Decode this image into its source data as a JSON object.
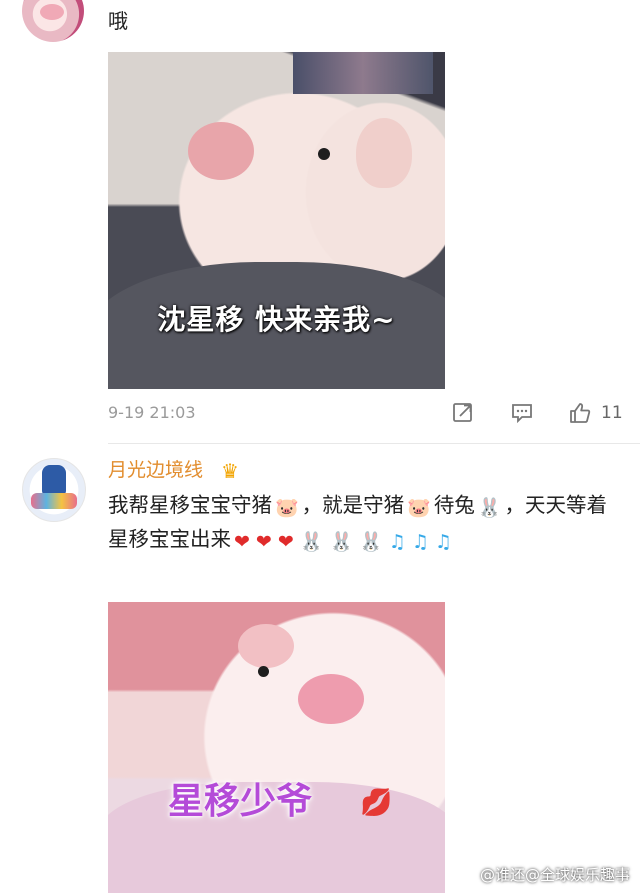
{
  "post1": {
    "text": "哦",
    "image_caption": "沈星移 快来亲我~",
    "time": "9-19 21:03",
    "likes": "11"
  },
  "post2": {
    "username": "月光边境线",
    "badge_icon": "crown-icon",
    "comment_line1": "我帮星移宝宝守猪",
    "comment_line2": "，就是守猪",
    "comment_line3": "待兔",
    "comment_line4": "，天天等着星移宝宝出来",
    "image_caption": "星移少爷"
  },
  "watermark": "@谁还@全球娱乐趣事",
  "colors": {
    "username": "#e28d2e",
    "time": "#9a9a9a",
    "heart": "#e02b2b",
    "note": "#36a9e8"
  }
}
